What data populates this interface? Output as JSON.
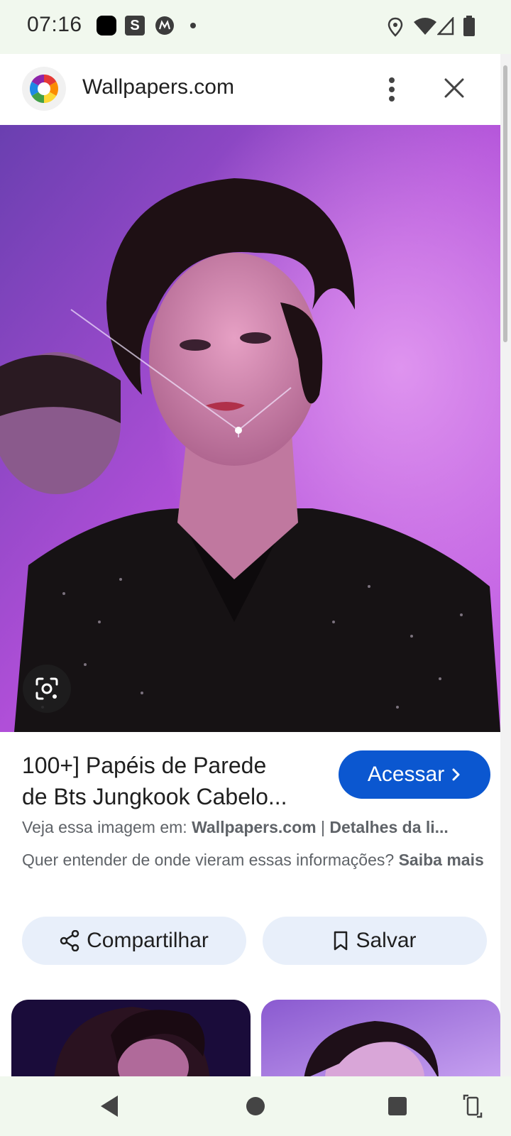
{
  "status_bar": {
    "time": "07:16",
    "icons": [
      "app-black-square-icon",
      "s-app-icon",
      "motorola-icon",
      "notification-dot-icon",
      "location-icon",
      "wifi-icon",
      "signal-icon",
      "battery-icon"
    ]
  },
  "header": {
    "site_name": "Wallpapers.com",
    "logo_icon": "color-wheel-logo",
    "more_icon": "more-vert-icon",
    "close_icon": "close-icon"
  },
  "main_image": {
    "lens_icon": "google-lens-icon"
  },
  "result": {
    "title_line1": "100+] Papéis de Parede",
    "title_line2": "de Bts Jungkook Cabelo...",
    "visit_label": "Acessar",
    "source_prefix": "Veja essa imagem em: ",
    "source_site": "Wallpapers.com",
    "source_sep": " | ",
    "source_details": "Detalhes da li...",
    "learn_text": "Quer entender de onde vieram essas informações? ",
    "learn_link": "Saiba mais"
  },
  "actions": {
    "share_label": "Compartilhar",
    "save_label": "Salvar"
  },
  "colors": {
    "status_bg": "#f1f8ee",
    "accent": "#0b57d0",
    "chip_bg": "#e8effa",
    "secondary_text": "#5f6368"
  },
  "nav_bar": {
    "icons": [
      "back-icon",
      "home-icon",
      "recents-icon",
      "rotate-icon"
    ]
  }
}
